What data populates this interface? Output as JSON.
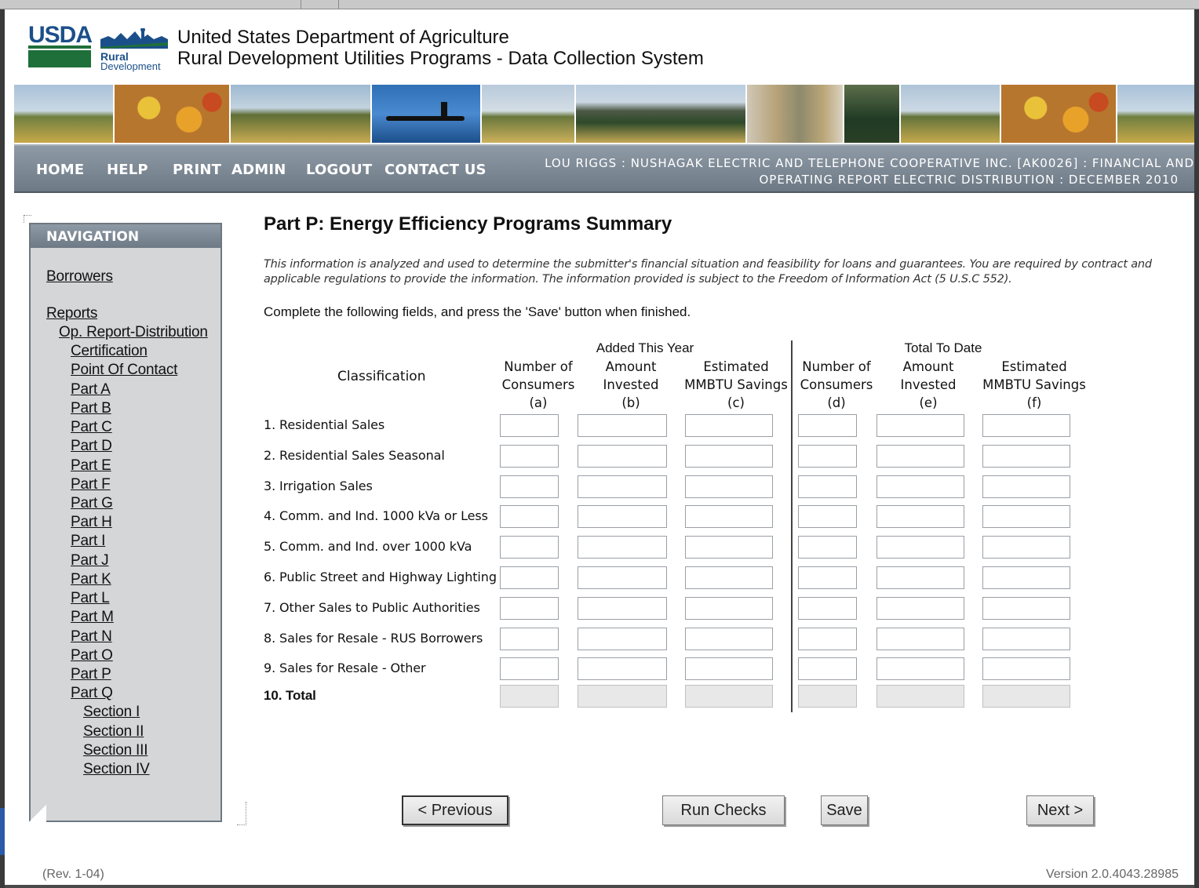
{
  "header": {
    "logo_text": "USDA",
    "logo_sub1": "Rural",
    "logo_sub2": "Development",
    "title_line1": "United States Department of Agriculture",
    "title_line2": "Rural Development Utilities Programs - Data Collection System"
  },
  "topnav": {
    "items": [
      "HOME",
      "HELP",
      "PRINT",
      "ADMIN",
      "LOGOUT",
      "CONTACT US"
    ],
    "user_line1": "LOU RIGGS : NUSHAGAK ELECTRIC AND TELEPHONE COOPERATIVE INC. [AK0026] : FINANCIAL AND",
    "user_line2": "OPERATING REPORT ELECTRIC DISTRIBUTION : DECEMBER 2010"
  },
  "sidebar": {
    "heading": "NAVIGATION",
    "borrowers": "Borrowers",
    "reports": "Reports",
    "op_report": "Op. Report-Distribution",
    "items": [
      "Certification",
      "Point Of Contact",
      "Part A",
      "Part B",
      "Part C",
      "Part D",
      "Part E",
      "Part F",
      "Part G",
      "Part H",
      "Part I",
      "Part J",
      "Part K",
      "Part L",
      "Part M",
      "Part N",
      "Part O",
      "Part P",
      "Part Q"
    ],
    "sections": [
      "Section I",
      "Section II",
      "Section III",
      "Section IV"
    ]
  },
  "main": {
    "title": "Part P: Energy Efficiency Programs Summary",
    "disclaimer_line1": "This information is analyzed and used to determine the submitter's financial situation and feasibility for loans and guarantees. You are required by contract and",
    "disclaimer_line2": "applicable regulations to provide the information. The information provided is subject to the Freedom of Information Act (5 U.S.C 552).",
    "instructions": "Complete the following fields, and press the 'Save' button when finished.",
    "group_added": "Added This Year",
    "group_total": "Total To Date",
    "classification_header": "Classification",
    "columns": [
      {
        "l1": "Number of",
        "l2": "Consumers",
        "l3": "(a)"
      },
      {
        "l1": "Amount",
        "l2": "Invested",
        "l3": "(b)"
      },
      {
        "l1": "Estimated",
        "l2": "MMBTU Savings",
        "l3": "(c)"
      },
      {
        "l1": "Number of",
        "l2": "Consumers",
        "l3": "(d)"
      },
      {
        "l1": "Amount",
        "l2": "Invested",
        "l3": "(e)"
      },
      {
        "l1": "Estimated",
        "l2": "MMBTU Savings",
        "l3": "(f)"
      }
    ],
    "rows": [
      "1. Residential Sales",
      "2. Residential Sales Seasonal",
      "3. Irrigation Sales",
      "4. Comm. and Ind. 1000 kVa or Less",
      "5. Comm. and Ind.  over 1000 kVa",
      "6. Public Street and Highway Lighting",
      "7. Other Sales to Public Authorities",
      "8. Sales for Resale - RUS Borrowers",
      "9. Sales for Resale - Other"
    ],
    "total_label": "10. Total"
  },
  "buttons": {
    "previous": "< Previous",
    "run_checks": "Run Checks",
    "save": "Save",
    "next": "Next >"
  },
  "footer": {
    "rev": "(Rev. 1-04)",
    "version": "Version 2.0.4043.28985"
  },
  "colors": {
    "nav_bar": "#7a8591",
    "usda_blue": "#1b4f8a",
    "usda_green": "#1f6f3a"
  }
}
